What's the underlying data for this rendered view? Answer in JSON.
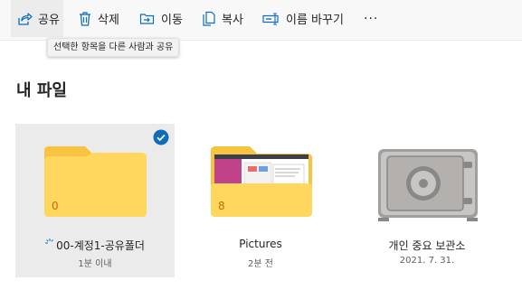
{
  "toolbar": {
    "share": "공유",
    "delete": "삭제",
    "move": "이동",
    "copy": "복사",
    "rename": "이름 바꾸기",
    "more": "···"
  },
  "tooltip": "선택한 항목을 다른 사람과 공유",
  "page": {
    "title": "내 파일"
  },
  "items": [
    {
      "name": "00-계정1-공유폴더",
      "meta": "1분 이내",
      "count": "0",
      "selected": true,
      "icon": "folder-icon"
    },
    {
      "name": "Pictures",
      "meta": "2분 전",
      "count": "8",
      "icon": "pictures-folder-icon"
    },
    {
      "name": "개인 중요 보관소",
      "meta": "2021. 7. 31.",
      "icon": "vault-icon"
    }
  ],
  "colors": {
    "accent": "#0f6cbd",
    "folder": "#ffd75e",
    "folder_back": "#f7c341",
    "count": "#c86b00"
  }
}
